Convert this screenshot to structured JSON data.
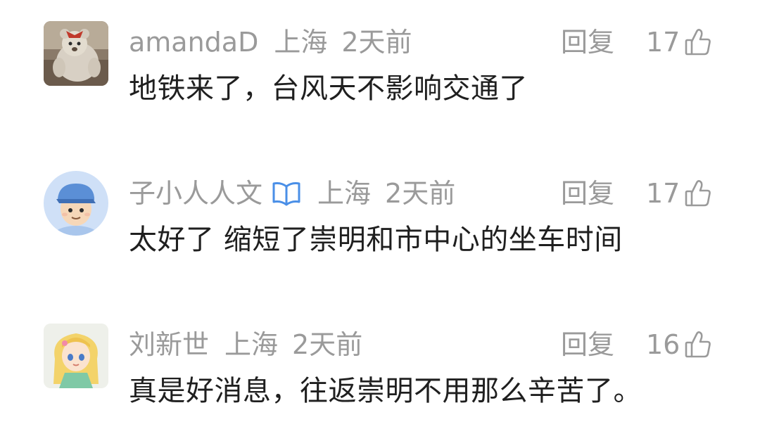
{
  "comments": [
    {
      "username": "amandaD",
      "location": "上海",
      "time": "2天前",
      "reply_label": "回复",
      "likes": "17",
      "text": "地铁来了，台风天不影响交通了",
      "verified": false,
      "avatar": "teddy-bear-photo"
    },
    {
      "username": "子小人人文",
      "location": "上海",
      "time": "2天前",
      "reply_label": "回复",
      "likes": "17",
      "text": "太好了 缩短了崇明和市中心的坐车时间",
      "verified": true,
      "avatar": "cartoon-boy-with-cap"
    },
    {
      "username": "刘新世",
      "location": "上海",
      "time": "2天前",
      "reply_label": "回复",
      "likes": "16",
      "text": "真是好消息，往返崇明不用那么辛苦了。",
      "verified": false,
      "avatar": "cartoon-girl-blonde"
    }
  ],
  "colors": {
    "meta": "#9a9a9a",
    "text": "#1f1f1f",
    "badge": "#4a8fe7"
  },
  "icons": {
    "like": "thumbs-up-outline-icon",
    "verified": "open-book-badge-icon"
  }
}
